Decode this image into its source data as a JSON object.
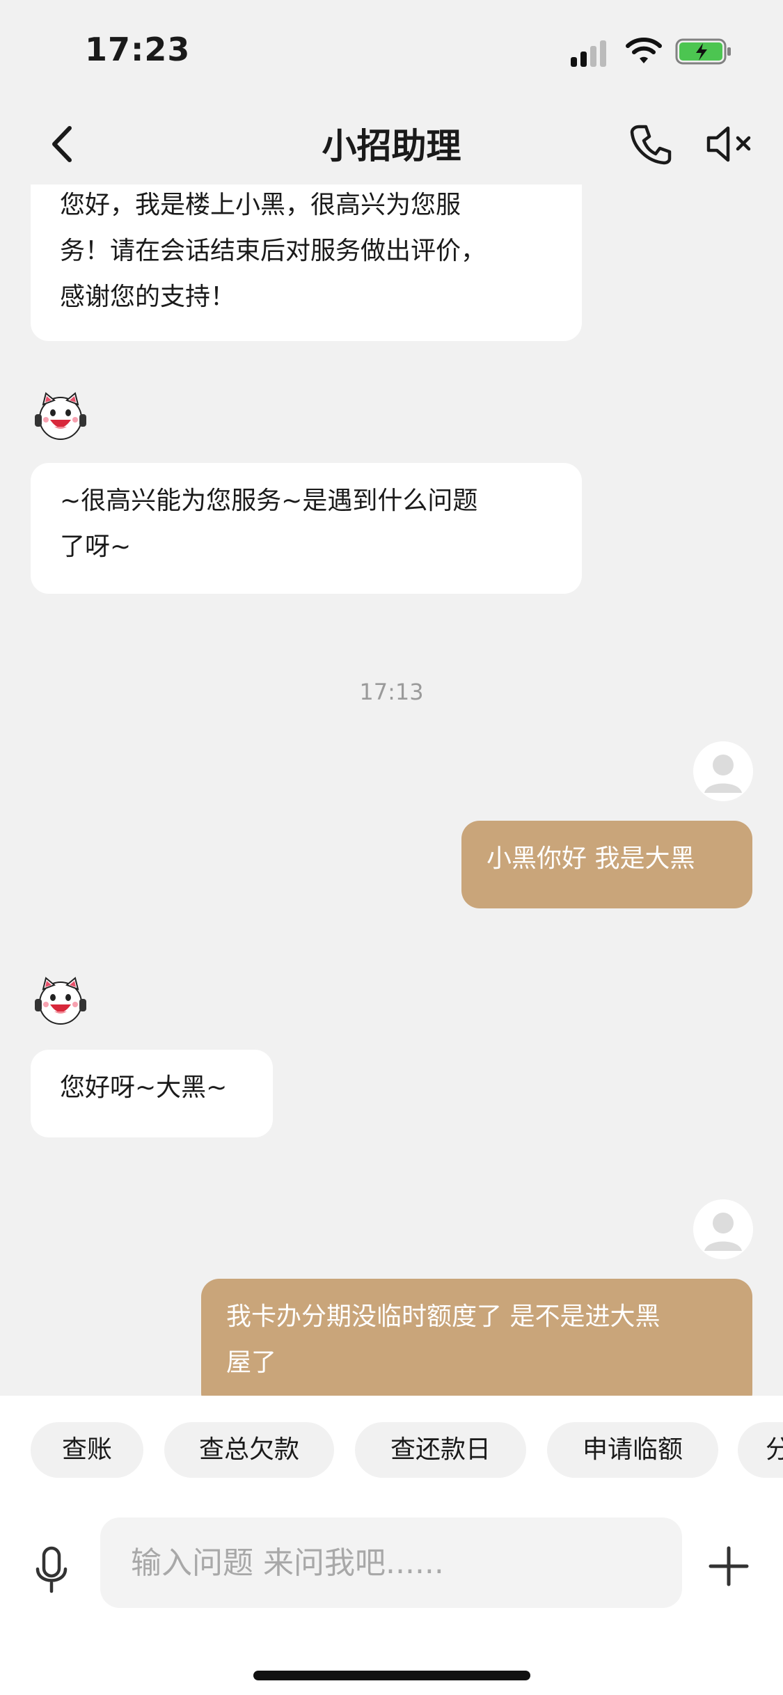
{
  "status_bar": {
    "time": "17:23"
  },
  "nav": {
    "title": "小招助理"
  },
  "messages": [
    {
      "sender": "bot",
      "lines": [
        "您好，我是楼上小黑，很高兴为您服",
        "务！请在会话结束后对服务做出评价，",
        "感谢您的支持！"
      ]
    },
    {
      "sender": "bot",
      "lines": [
        "~很高兴能为您服务~是遇到什么问题",
        "了呀~"
      ]
    },
    {
      "type": "timestamp",
      "text": "17:13"
    },
    {
      "sender": "user",
      "lines": [
        "小黑你好 我是大黑"
      ]
    },
    {
      "sender": "bot",
      "lines": [
        "您好呀~大黑~"
      ]
    },
    {
      "sender": "user",
      "lines": [
        "我卡办分期没临时额度了 是不是进大黑",
        "屋了"
      ]
    }
  ],
  "quick_replies": [
    "查账",
    "查总欠款",
    "查还款日",
    "申请临额",
    "分"
  ],
  "input": {
    "placeholder": "输入问题 来问我吧......",
    "value": ""
  },
  "colors": {
    "background": "#f1f1f1",
    "user_bubble": "#c9a57a",
    "bot_bubble": "#ffffff",
    "battery": "#4cc551"
  },
  "icons": [
    "back-arrow-icon",
    "phone-icon",
    "speaker-mute-icon",
    "bot-avatar-icon",
    "user-avatar-icon",
    "microphone-icon",
    "plus-icon",
    "signal-icon",
    "wifi-icon",
    "battery-charging-icon"
  ]
}
